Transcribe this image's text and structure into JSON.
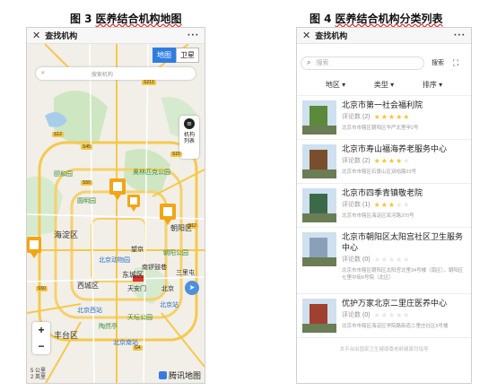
{
  "captions": {
    "left_num": "图 3",
    "left_text": "医养结合机构地图",
    "right_num": "图 4",
    "right_text": "医养结合机构分类列表"
  },
  "map_screen": {
    "title": "查找机构",
    "more": "···",
    "toggle": {
      "map": "地图",
      "satellite": "卫星"
    },
    "search_placeholder": "搜索机构",
    "list_button": "机构\n列表",
    "list_button_line1": "机构",
    "list_button_line2": "列表",
    "zoom_in": "+",
    "zoom_out": "−",
    "scale_top": "5 公里",
    "scale_bottom": "2 英里",
    "brand": "腾讯地图",
    "labels": {
      "haidian": "海淀区",
      "chaoyang": "朝阳区",
      "dongcheng": "东城区",
      "xicheng": "西城区",
      "fengtai": "丰台区",
      "beijing_zoo": "北京动物园",
      "beijing_station": "北京站",
      "beijing_west": "北京西站",
      "beijing_south": "北京南站",
      "summer_palace": "颐和园",
      "olympic_park": "奥林匹克公园",
      "yuanmingyuan": "圆明园",
      "temple_heaven": "天坛公园",
      "sanlitun": "三里屯",
      "wangjing": "望京",
      "nanluoguxiang": "南锣鼓巷",
      "beijing_text": "北京",
      "chaoyang_park": "朝阳公园",
      "tiananmen": "天安门",
      "taoranting": "陶然亭"
    },
    "shields": [
      "S213",
      "S12",
      "S45",
      "S50",
      "S12",
      "S50",
      "G4",
      "S15"
    ]
  },
  "list_screen": {
    "title": "查找机构",
    "more": "···",
    "search_placeholder": "搜索",
    "search_button": "搜索",
    "filters": [
      "地区",
      "类型",
      "排序"
    ],
    "items": [
      {
        "name": "北京市第一社会福利院",
        "review_label": "评论数",
        "review_count": "(2)",
        "stars": 5,
        "address": "北京市市辖区朝阳区华严北里甲2号",
        "thumb_color": "#5a8a3a"
      },
      {
        "name": "北京市寿山福海养老服务中心",
        "review_label": "评论数",
        "review_count": "(2)",
        "stars": 4,
        "address": "北京市市辖区石景山区双峪路23号",
        "thumb_color": "#7a4e2c"
      },
      {
        "name": "北京市四季青镇敬老院",
        "review_label": "评论数",
        "review_count": "(1)",
        "stars": 3,
        "address": "北京市市辖区海淀区旱河路370号",
        "thumb_color": "#3a6a4a"
      },
      {
        "name": "北京市朝阳区太阳宫社区卫生服务中心",
        "review_label": "评论数",
        "review_count": "(0)",
        "stars": 0,
        "address": "北京市市辖区朝阳区太阳宫北里34号楼（南区），朝阳区七里中街6号院（北区）",
        "thumb_color": "#8aa0b8"
      },
      {
        "name": "优护万家北京二里庄医养中心",
        "review_label": "评论数",
        "review_count": "(0)",
        "stars": 0,
        "address": "北京市市辖区海淀区学院路街道二里庄社区5号楼",
        "thumb_color": "#a04030"
      }
    ],
    "footnote": "本平台由国家卫生健康委老龄健康司指导"
  }
}
